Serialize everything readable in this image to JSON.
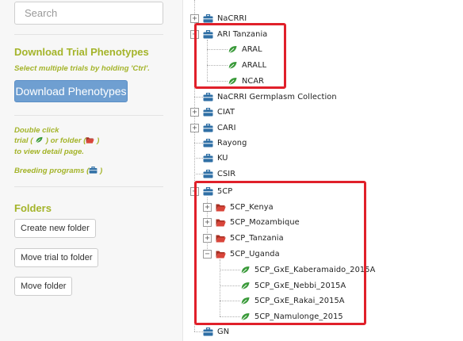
{
  "sidebar": {
    "search_placeholder": "Search",
    "download_heading": "Download Trial Phenotypes",
    "download_hint": "Select multiple trials by holding 'Ctrl'.",
    "download_button": "Download Phenotypes",
    "help_line1": "Double click",
    "help_line2a": "trial (",
    "help_line2b": " ) or folder (",
    "help_line2c": ")",
    "help_line3": "to view detail page.",
    "breeding_a": "Breeding programs (",
    "breeding_b": " )",
    "folders_heading": "Folders",
    "buttons": [
      "Create new folder",
      "Move trial to folder",
      "Move folder"
    ]
  },
  "tree": {
    "nodes": [
      {
        "label": "NaCRRI",
        "type": "program"
      },
      {
        "label": "ARI Tanzania",
        "type": "program"
      },
      {
        "label": "ARAL",
        "type": "trial"
      },
      {
        "label": "ARALL",
        "type": "trial"
      },
      {
        "label": "NCAR",
        "type": "trial"
      },
      {
        "label": "NaCRRI Germplasm Collection",
        "type": "program"
      },
      {
        "label": "CIAT",
        "type": "program"
      },
      {
        "label": "CARI",
        "type": "program"
      },
      {
        "label": "Rayong",
        "type": "program"
      },
      {
        "label": "KU",
        "type": "program"
      },
      {
        "label": "CSIR",
        "type": "program"
      },
      {
        "label": "5CP",
        "type": "program"
      },
      {
        "label": "5CP_Kenya",
        "type": "folder"
      },
      {
        "label": "5CP_Mozambique",
        "type": "folder"
      },
      {
        "label": "5CP_Tanzania",
        "type": "folder"
      },
      {
        "label": "5CP_Uganda",
        "type": "folder"
      },
      {
        "label": "5CP_GxE_Kaberamaido_2015A",
        "type": "trial"
      },
      {
        "label": "5CP_GxE_Nebbi_2015A",
        "type": "trial"
      },
      {
        "label": "5CP_GxE_Rakai_2015A",
        "type": "trial"
      },
      {
        "label": "5CP_Namulonge_2015",
        "type": "trial"
      },
      {
        "label": "GN",
        "type": "program"
      }
    ]
  },
  "colors": {
    "accent_green": "#a4b42a",
    "button_blue": "#6f9fd1",
    "highlight_red": "#e0202a",
    "program_icon": "#2f6fa5",
    "folder_icon": "#c0392b",
    "trial_icon": "#3a9a3a"
  }
}
